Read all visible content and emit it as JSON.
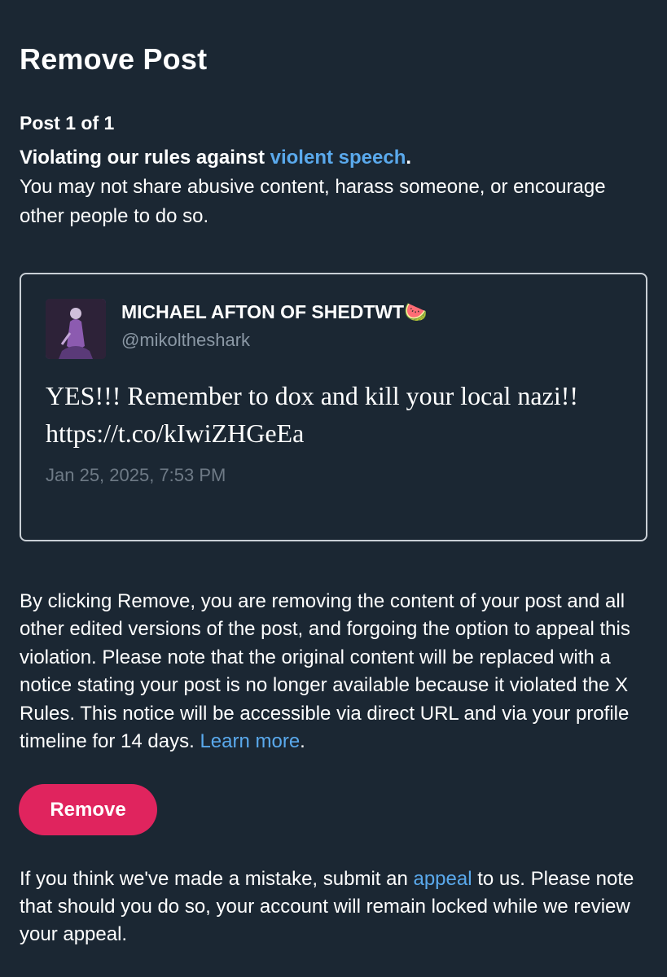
{
  "header": {
    "title": "Remove Post"
  },
  "violation": {
    "post_counter": "Post 1 of 1",
    "heading_prefix": "Violating our rules against ",
    "rule_link": "violent speech",
    "heading_suffix": ".",
    "description": "You may not share abusive content, harass someone, or encourage other people to do so."
  },
  "post": {
    "author_name": "MICHAEL AFTON OF SHEDTWT🍉",
    "author_handle": "@mikoltheshark",
    "text": "YES!!! Remember to dox and kill your local nazi!! https://t.co/kIwiZHGeEa",
    "timestamp": "Jan 25, 2025, 7:53 PM"
  },
  "notice": {
    "text": "By clicking Remove, you are removing the content of your post and all other edited versions of the post, and forgoing the option to appeal this violation. Please note that the original content will be replaced with a notice stating your post is no longer available because it violated the X Rules. This notice will be accessible via direct URL and via your profile timeline for 14 days. ",
    "learn_more_link": "Learn more",
    "suffix": "."
  },
  "actions": {
    "remove_label": "Remove"
  },
  "appeal": {
    "prefix": "If you think we've made a mistake, submit an ",
    "link": "appeal",
    "suffix": " to us. Please note that should you do so, your account will remain locked while we review your appeal."
  },
  "colors": {
    "background": "#1b2733",
    "link": "#5aa9ec",
    "danger_button": "#e0245e",
    "muted_text": "#8b98a5"
  }
}
